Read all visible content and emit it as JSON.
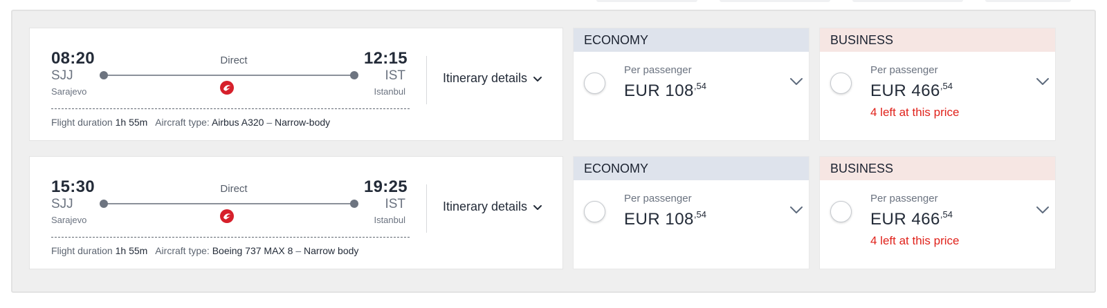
{
  "colors": {
    "economy_header": "#dee3ec",
    "business_header": "#f6e6e3",
    "warning": "#e0221b",
    "airline_logo": "#d6202b"
  },
  "flights": [
    {
      "departure": {
        "time": "08:20",
        "code": "SJJ",
        "city": "Sarajevo"
      },
      "arrival": {
        "time": "12:15",
        "code": "IST",
        "city": "Istanbul"
      },
      "stops": "Direct",
      "airline_icon": "turkish-airlines-logo-icon",
      "duration_label": "Flight duration",
      "duration": "1h 55m",
      "aircraft_label": "Aircraft type:",
      "aircraft": "Airbus A320",
      "separator": "–",
      "body": "Narrow-body",
      "itinerary_label": "Itinerary details",
      "fares": {
        "economy": {
          "title": "ECONOMY",
          "per_passenger": "Per passenger",
          "currency_amount": "EUR 108",
          "cents": ",54",
          "note": ""
        },
        "business": {
          "title": "BUSINESS",
          "per_passenger": "Per passenger",
          "currency_amount": "EUR 466",
          "cents": ",54",
          "note": "4 left at this price"
        }
      }
    },
    {
      "departure": {
        "time": "15:30",
        "code": "SJJ",
        "city": "Sarajevo"
      },
      "arrival": {
        "time": "19:25",
        "code": "IST",
        "city": "Istanbul"
      },
      "stops": "Direct",
      "airline_icon": "turkish-airlines-logo-icon",
      "duration_label": "Flight duration",
      "duration": "1h 55m",
      "aircraft_label": "Aircraft type:",
      "aircraft": "Boeing 737 MAX 8",
      "separator": "–",
      "body": "Narrow body",
      "itinerary_label": "Itinerary details",
      "fares": {
        "economy": {
          "title": "ECONOMY",
          "per_passenger": "Per passenger",
          "currency_amount": "EUR 108",
          "cents": ",54",
          "note": ""
        },
        "business": {
          "title": "BUSINESS",
          "per_passenger": "Per passenger",
          "currency_amount": "EUR 466",
          "cents": ",54",
          "note": "4 left at this price"
        }
      }
    }
  ]
}
